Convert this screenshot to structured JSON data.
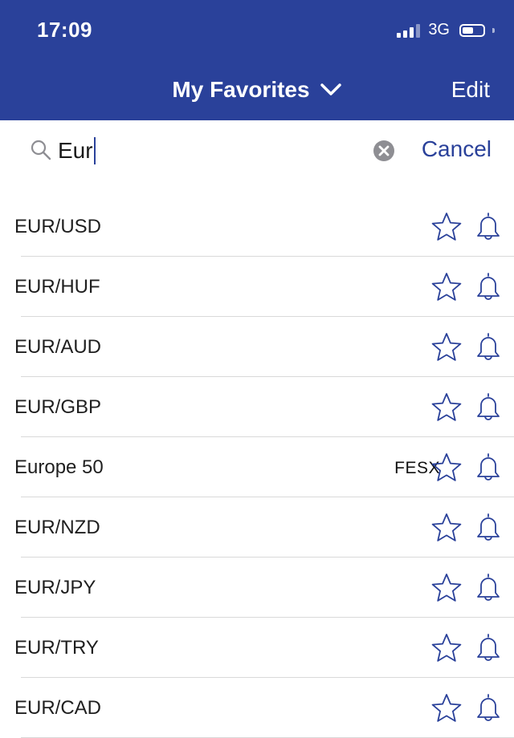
{
  "status_bar": {
    "time": "17:09",
    "network": "3G",
    "battery_level": 0.55
  },
  "nav": {
    "title": "My Favorites",
    "edit_label": "Edit"
  },
  "search": {
    "query": "Eur",
    "cancel_label": "Cancel"
  },
  "results": [
    {
      "label": "EUR/USD",
      "code": ""
    },
    {
      "label": "EUR/HUF",
      "code": ""
    },
    {
      "label": "EUR/AUD",
      "code": ""
    },
    {
      "label": "EUR/GBP",
      "code": ""
    },
    {
      "label": "Europe 50",
      "code": "FESX"
    },
    {
      "label": "EUR/NZD",
      "code": ""
    },
    {
      "label": "EUR/JPY",
      "code": ""
    },
    {
      "label": "EUR/TRY",
      "code": ""
    },
    {
      "label": "EUR/CAD",
      "code": ""
    }
  ],
  "colors": {
    "brand": "#2a419a",
    "icon_outline": "#2a419a",
    "separator": "#d9d9d9"
  },
  "icons": {
    "dropdown": "chevron-down-icon",
    "search": "search-icon",
    "clear": "clear-icon",
    "favorite": "star-icon",
    "alert": "bell-icon"
  }
}
